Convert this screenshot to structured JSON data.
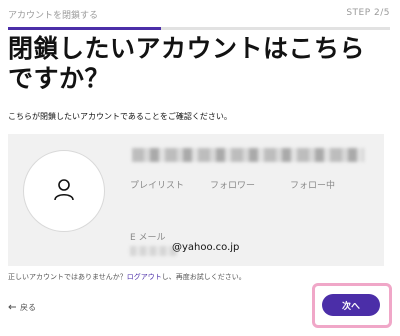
{
  "header": {
    "title": "アカウントを閉鎖する",
    "step": "STEP 2/5"
  },
  "progress": {
    "fraction": 0.4,
    "color": "#4b2ea8"
  },
  "main": {
    "title": "閉鎖したいアカウントはこちらですか？",
    "subtitle": "こちらが閉鎖したいアカウントであることをご確認ください。"
  },
  "profile": {
    "avatar_icon": "user-icon",
    "stats": [
      "プレイリスト",
      "フォロワー",
      "フォロー中"
    ],
    "email_label": "E メール",
    "email_value": "@yahoo.co.jp"
  },
  "note": {
    "prefix": "正しいアカウントではありませんか？",
    "link": "ログアウト",
    "suffix": "し、再度お試しください。"
  },
  "footer": {
    "back_label": "戻る",
    "next_label": "次へ"
  }
}
